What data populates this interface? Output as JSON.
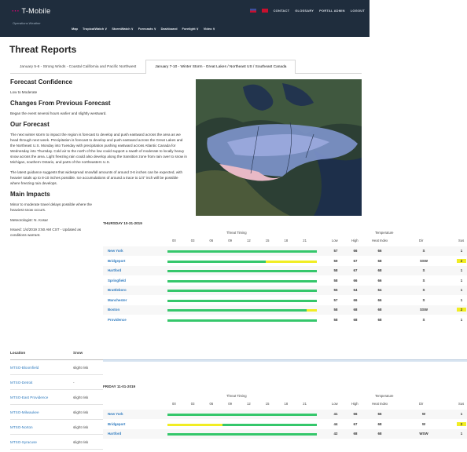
{
  "header": {
    "brand": "T-Mobile",
    "brand_sub": "Operations Weather",
    "top_links": [
      "CONTACT",
      "GLOSSARY",
      "PORTAL ADMIN",
      "LOGOUT"
    ],
    "nav": [
      "Map",
      "TropicalWatch ∨",
      "StormWatch ∨",
      "Forecasts ∨",
      "Dashboard",
      "Forelight ∨",
      "Video ∨"
    ]
  },
  "page_title": "Threat Reports",
  "tabs": [
    {
      "label": "January 5-6 - Strong Winds - Coastal California and Pacific Northwest",
      "active": false
    },
    {
      "label": "January 7-10 - Winter Storm - Great Lakes / Northeast US / Southeast Canada",
      "active": true
    }
  ],
  "forecast": {
    "confidence_title": "Forecast Confidence",
    "confidence_text": "Low to Moderate",
    "changes_title": "Changes From Previous Forecast",
    "changes_text": "Began the event several hours earlier and slightly westward.",
    "our_title": "Our Forecast",
    "our_p1": "The next winter storm to impact the region is forecast to develop and push eastward across the area as we head through next week. Precipitation is forecast to develop and push eastward across the Great Lakes and the Northeast U.S. Monday into Tuesday with precipitation pushing eastward across Atlantic Canada for Wednesday into Thursday. Cold air to the north of the low could support a swath of moderate to locally heavy snow across the area. Light freezing rain could also develop along the transition zone from rain over to snow in Michigan, southern Ontario, and parts of the northeastern U.S.",
    "our_p2": "The latest guidance suggests that widespread snowfall amounts of around 3-6 inches can be expected, with heavier totals up to 8-10 inches possible. Ice accumulations of around a trace to 1/4\" inch will be possible where freezing rain develops.",
    "impacts_title": "Main Impacts",
    "impacts_text": "Minor to moderate travel delays possible where the heaviest snow occurs.",
    "meteorologist": "Meteorologist: N. Kosar",
    "issued": "Issued: 1/4/2019 3:50 AM CST - Updated as conditions warrant."
  },
  "locations": {
    "headers": [
      "Location",
      "Snow"
    ],
    "rows": [
      [
        "MTSO-Bloomfield",
        "slight risk"
      ],
      [
        "MTSO-Detroit",
        "-"
      ],
      [
        "MTSO-East Providence",
        "slight risk"
      ],
      [
        "MTSO-Milwaukee",
        "slight risk"
      ],
      [
        "MTSO-Norton",
        "slight risk"
      ],
      [
        "MTSO-Syracuse",
        "slight risk"
      ]
    ]
  },
  "days": [
    {
      "label": "THURSDAY 10-31-2019",
      "threat_title": "Threat Timing",
      "temp_title": "Temperature",
      "hours": [
        "00",
        "03",
        "06",
        "09",
        "12",
        "15",
        "18",
        "21"
      ],
      "cols": [
        "Low",
        "High",
        "Heat Index",
        "Dir",
        "Sus"
      ],
      "rows": [
        {
          "city": "New York",
          "yellow_from": null,
          "low": "57",
          "high": "66",
          "heat": "66",
          "dir": "S",
          "sus": "1",
          "hl": false
        },
        {
          "city": "Bridgeport",
          "yellow_from": 0.66,
          "low": "59",
          "high": "67",
          "heat": "68",
          "dir": "SSW",
          "sus": "2",
          "hl": true
        },
        {
          "city": "Hartford",
          "yellow_from": null,
          "low": "58",
          "high": "67",
          "heat": "68",
          "dir": "S",
          "sus": "1",
          "hl": false
        },
        {
          "city": "Springfield",
          "yellow_from": null,
          "low": "58",
          "high": "66",
          "heat": "66",
          "dir": "S",
          "sus": "1",
          "hl": false
        },
        {
          "city": "Brattleboro",
          "yellow_from": null,
          "low": "55",
          "high": "64",
          "heat": "64",
          "dir": "S",
          "sus": "1",
          "hl": false
        },
        {
          "city": "Manchester",
          "yellow_from": null,
          "low": "57",
          "high": "66",
          "heat": "66",
          "dir": "S",
          "sus": "1",
          "hl": false
        },
        {
          "city": "Boston",
          "yellow_from": 0.93,
          "low": "58",
          "high": "68",
          "heat": "68",
          "dir": "SSW",
          "sus": "2",
          "hl": true
        },
        {
          "city": "Providence",
          "yellow_from": null,
          "low": "58",
          "high": "68",
          "heat": "68",
          "dir": "S",
          "sus": "1",
          "hl": false
        }
      ]
    },
    {
      "label": "FRIDAY 11-01-2019",
      "threat_title": "Threat Timing",
      "temp_title": "Temperature",
      "hours": [
        "00",
        "03",
        "06",
        "09",
        "12",
        "15",
        "18",
        "21"
      ],
      "cols": [
        "Low",
        "High",
        "Heat Index",
        "Dir",
        "Sus"
      ],
      "rows": [
        {
          "city": "New York",
          "yellow_to": null,
          "low": "41",
          "high": "66",
          "heat": "66",
          "dir": "W",
          "sus": "1",
          "hl": false
        },
        {
          "city": "Bridgeport",
          "yellow_to": 0.37,
          "low": "44",
          "high": "67",
          "heat": "68",
          "dir": "W",
          "sus": "2",
          "hl": true
        },
        {
          "city": "Hartford",
          "yellow_to": null,
          "low": "42",
          "high": "68",
          "heat": "68",
          "dir": "WSW",
          "sus": "1",
          "hl": false
        }
      ]
    }
  ],
  "colors": {
    "header_bg": "#1f2d3d",
    "brand_magenta": "#e20074",
    "risk_green": "#35c76b",
    "risk_yellow": "#f1ed24",
    "link_blue": "#2f7bbf"
  }
}
